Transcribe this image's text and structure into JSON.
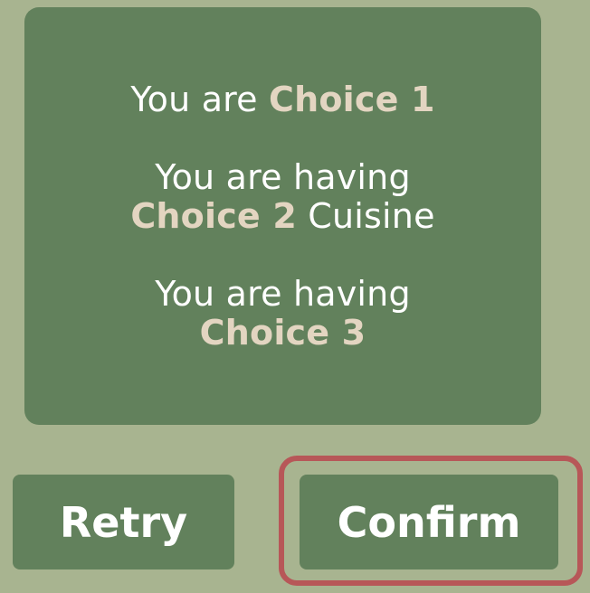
{
  "summary": {
    "line1_prefix": "You are",
    "choice1": "Choice 1",
    "line2_prefix": "You are having",
    "choice2": "Choice 2",
    "line2_suffix": "Cuisine",
    "line3_prefix": "You are having",
    "choice3": "Choice 3"
  },
  "buttons": {
    "retry_label": "Retry",
    "confirm_label": "Confirm"
  },
  "colors": {
    "background": "#a8b490",
    "panel": "#62815c",
    "choice_text": "#e3d5c1",
    "highlight": "#b75758"
  }
}
